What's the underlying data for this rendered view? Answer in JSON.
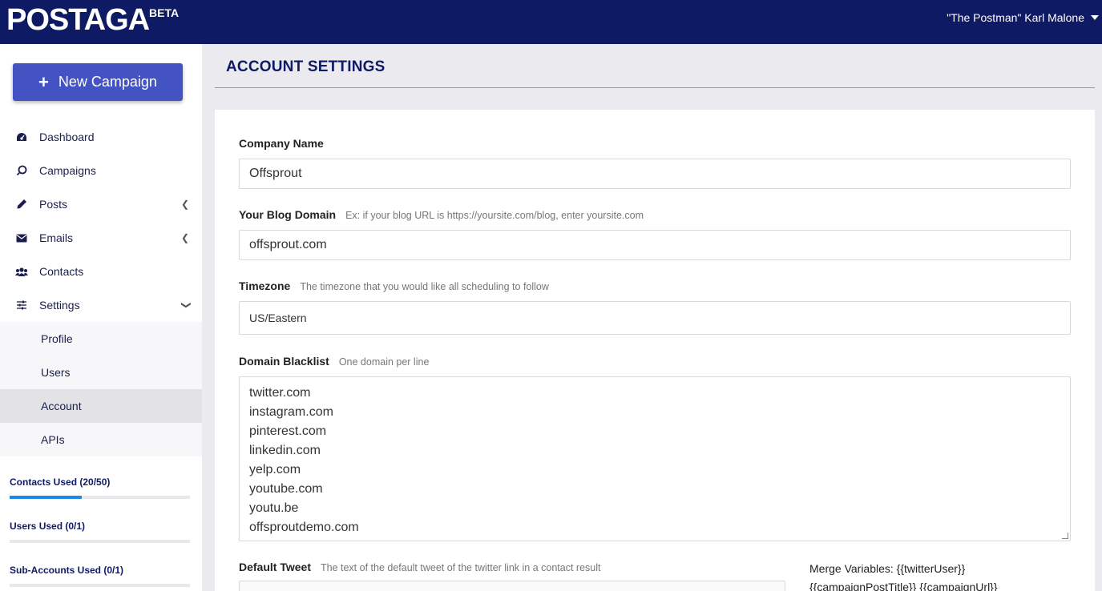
{
  "header": {
    "logo": "POSTAGA",
    "badge": "BETA",
    "user_name": "\"The Postman\" Karl Malone"
  },
  "sidebar": {
    "new_campaign_label": "New Campaign",
    "nav": [
      {
        "label": "Dashboard",
        "icon": "dashboard-icon"
      },
      {
        "label": "Campaigns",
        "icon": "campaigns-icon"
      },
      {
        "label": "Posts",
        "icon": "pencil-icon"
      },
      {
        "label": "Emails",
        "icon": "envelope-icon"
      },
      {
        "label": "Contacts",
        "icon": "users-icon"
      },
      {
        "label": "Settings",
        "icon": "sliders-icon"
      }
    ],
    "settings_sub": [
      {
        "label": "Profile"
      },
      {
        "label": "Users"
      },
      {
        "label": "Account",
        "active": true
      },
      {
        "label": "APIs"
      }
    ],
    "usage": [
      {
        "label": "Contacts Used (20/50)",
        "used": 20,
        "total": 50
      },
      {
        "label": "Users Used (0/1)",
        "used": 0,
        "total": 1
      },
      {
        "label": "Sub-Accounts Used (0/1)",
        "used": 0,
        "total": 1
      }
    ]
  },
  "main": {
    "title": "ACCOUNT SETTINGS",
    "company": {
      "label": "Company Name",
      "value": "Offsprout"
    },
    "blog_domain": {
      "label": "Your Blog Domain",
      "hint": "Ex: if your blog URL is https://yoursite.com/blog, enter yoursite.com",
      "value": "offsprout.com"
    },
    "timezone": {
      "label": "Timezone",
      "hint": "The timezone that you would like all scheduling to follow",
      "value": "US/Eastern"
    },
    "blacklist": {
      "label": "Domain Blacklist",
      "hint": "One domain per line",
      "value": "twitter.com\ninstagram.com\npinterest.com\nlinkedin.com\nyelp.com\nyoutube.com\nyoutu.be\noffsproutdemo.com"
    },
    "default_tweet": {
      "label": "Default Tweet",
      "hint": "The text of the default tweet of the twitter link in a contact result",
      "value": ""
    },
    "merge_variables": "Merge Variables: {{twitterUser}} {{campaignPostTitle}} {{campaignUrl}}"
  },
  "colors": {
    "topbar": "#0e1a63",
    "primary_button": "#4354c2",
    "progress": "#1e88e5"
  }
}
